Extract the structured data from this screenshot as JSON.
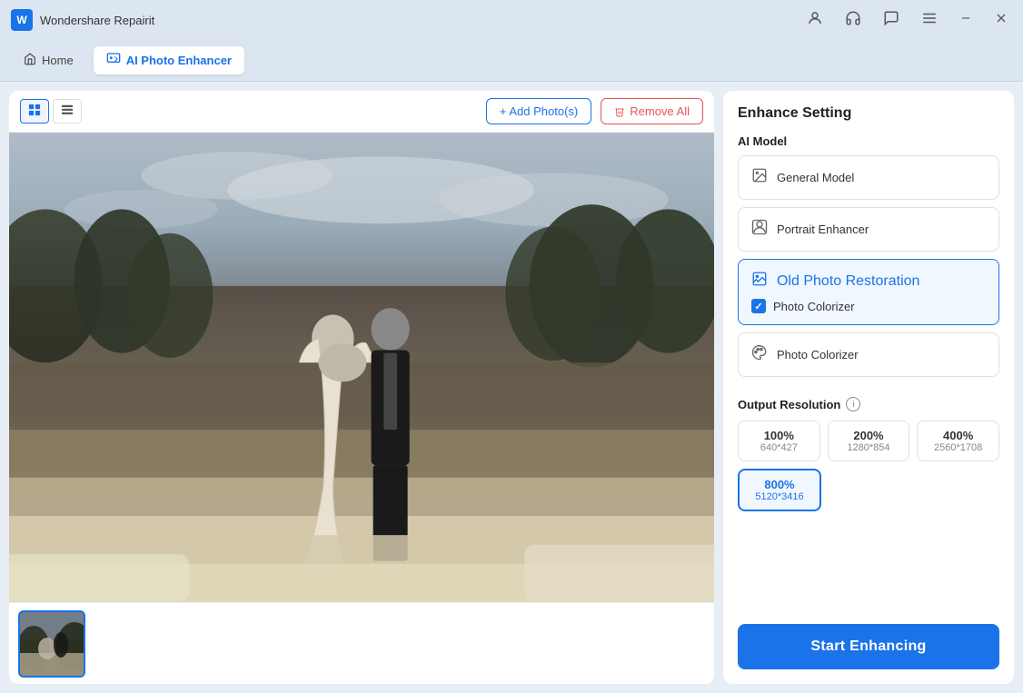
{
  "titlebar": {
    "app_name": "Wondershare Repairit",
    "icons": [
      "user-icon",
      "headphone-icon",
      "chat-icon",
      "menu-icon",
      "minimize-icon",
      "close-icon"
    ]
  },
  "navbar": {
    "tabs": [
      {
        "id": "home",
        "label": "Home",
        "icon": "home-icon",
        "active": false
      },
      {
        "id": "ai-photo-enhancer",
        "label": "AI Photo Enhancer",
        "icon": "ai-icon",
        "active": true
      }
    ]
  },
  "toolbar": {
    "view_grid_label": "⊞",
    "view_list_label": "≡",
    "add_photos_label": "+ Add Photo(s)",
    "remove_all_label": "Remove All"
  },
  "enhance_setting": {
    "title": "Enhance Setting",
    "ai_model_label": "AI Model",
    "models": [
      {
        "id": "general",
        "label": "General Model",
        "icon": "image-icon",
        "active": false
      },
      {
        "id": "portrait",
        "label": "Portrait Enhancer",
        "icon": "portrait-icon",
        "active": false
      },
      {
        "id": "old-photo",
        "label": "Old Photo Restoration",
        "icon": "old-photo-icon",
        "active": true
      },
      {
        "id": "colorizer",
        "label": "Photo Colorizer",
        "icon": "colorizer-icon",
        "active": false
      }
    ],
    "photo_colorizer_checkbox": {
      "checked": true,
      "label": "Photo Colorizer"
    },
    "output_resolution_label": "Output Resolution",
    "resolutions": [
      {
        "pct": "100%",
        "dim": "640*427",
        "active": false
      },
      {
        "pct": "200%",
        "dim": "1280*854",
        "active": false
      },
      {
        "pct": "400%",
        "dim": "2560*1708",
        "active": false
      },
      {
        "pct": "800%",
        "dim": "5120*3416",
        "active": true
      }
    ],
    "start_button_label": "Start Enhancing"
  }
}
